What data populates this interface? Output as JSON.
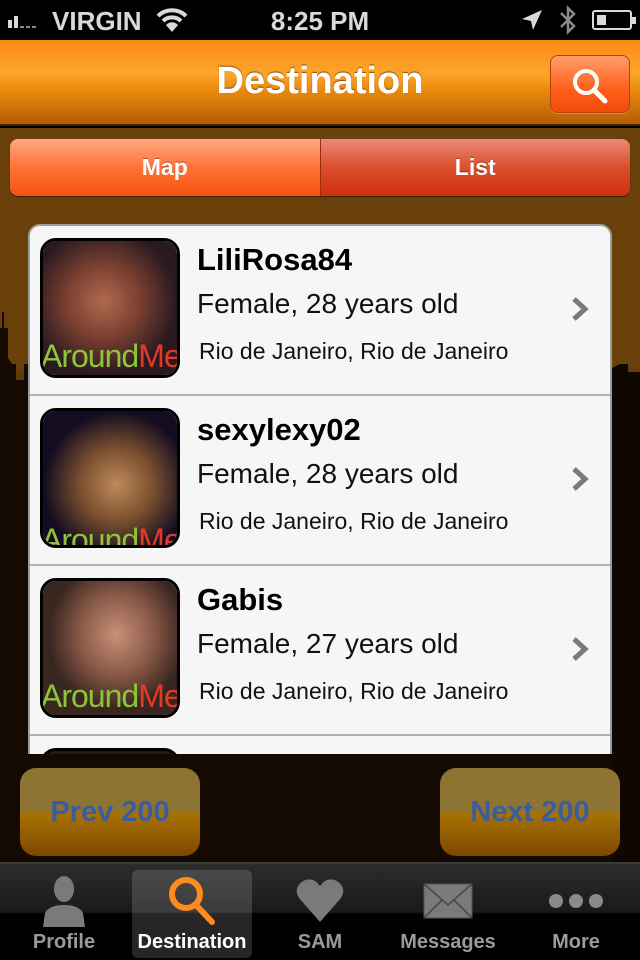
{
  "status_bar": {
    "carrier": "VIRGIN",
    "time": "8:25 PM",
    "signal_bars_filled": 2,
    "signal_bars_total": 5,
    "battery_level": 0.3,
    "icons": [
      "signal-icon",
      "wifi-icon",
      "location-arrow-icon",
      "bluetooth-icon",
      "battery-icon"
    ]
  },
  "nav_bar": {
    "title": "Destination",
    "search_icon": "magnifier-icon"
  },
  "segmented_control": {
    "segments": [
      {
        "label": "Map",
        "selected": false
      },
      {
        "label": "List",
        "selected": true
      }
    ]
  },
  "users": [
    {
      "username": "LiliRosa84",
      "details": "Female, 28 years old",
      "location": "Rio de Janeiro, Rio de Janeiro",
      "watermark_a": "Around",
      "watermark_b": "Me"
    },
    {
      "username": "sexylexy02",
      "details": "Female, 28 years old",
      "location": "Rio de Janeiro, Rio de Janeiro",
      "watermark_a": "Around",
      "watermark_b": "Me"
    },
    {
      "username": "Gabis",
      "details": "Female, 27 years old",
      "location": "Rio de Janeiro, Rio de Janeiro",
      "watermark_a": "Around",
      "watermark_b": "Me"
    }
  ],
  "pager": {
    "prev_label": "Prev 200",
    "next_label": "Next 200"
  },
  "tab_bar": {
    "tabs": [
      {
        "label": "Profile",
        "icon": "person-icon",
        "active": false
      },
      {
        "label": "Destination",
        "icon": "magnifier-icon",
        "active": true
      },
      {
        "label": "SAM",
        "icon": "heart-icon",
        "active": false
      },
      {
        "label": "Messages",
        "icon": "envelope-icon",
        "active": false
      },
      {
        "label": "More",
        "icon": "ellipsis-icon",
        "active": false
      }
    ]
  },
  "colors": {
    "accent_orange": "#ff7238",
    "nav_orange": "#fda52a",
    "pager_text": "#3b5ca0",
    "tab_active_icon": "#ff8a1e"
  }
}
